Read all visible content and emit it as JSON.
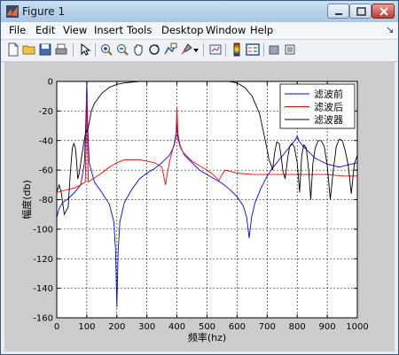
{
  "window": {
    "title": "Figure 1"
  },
  "menu": [
    "File",
    "Edit",
    "View",
    "Insert",
    "Tools",
    "Desktop",
    "Window",
    "Help"
  ],
  "toolbar_icons": [
    "new-file-icon",
    "open-folder-icon",
    "save-icon",
    "print-icon",
    "arrow-pointer-icon",
    "zoom-in-icon",
    "zoom-out-icon",
    "pan-hand-icon",
    "rotate-3d-icon",
    "data-cursor-icon",
    "brush-icon",
    "link-plot-icon",
    "colorbar-icon",
    "legend-icon",
    "hide-tools-icon",
    "show-tools-icon"
  ],
  "chart_data": {
    "type": "line",
    "title": "",
    "xlabel": "频率(hz)",
    "ylabel": "幅度(db)",
    "xlim": [
      0,
      1000
    ],
    "ylim": [
      -160,
      0
    ],
    "xticks": [
      "0",
      "100",
      "200",
      "300",
      "400",
      "500",
      "600",
      "700",
      "800",
      "900",
      "1000"
    ],
    "yticks": [
      "0",
      "-20",
      "-40",
      "-60",
      "-80",
      "-100",
      "-120",
      "-140",
      "-160"
    ],
    "grid": true,
    "legend_position": "top-right",
    "series": [
      {
        "name": "滤波前",
        "color": "#0000ff",
        "x": [
          0,
          8,
          20,
          40,
          60,
          80,
          92,
          97,
          100,
          103,
          108,
          125,
          150,
          175,
          190,
          196,
          200,
          204,
          210,
          225,
          250,
          275,
          300,
          325,
          350,
          375,
          390,
          397,
          400,
          403,
          410,
          425,
          450,
          475,
          500,
          525,
          550,
          575,
          600,
          620,
          632,
          640,
          648,
          660,
          680,
          700,
          720,
          740,
          760,
          780,
          795,
          800,
          805,
          820,
          840,
          860,
          880,
          900,
          920,
          940,
          960,
          980,
          1000
        ],
        "y": [
          -92,
          -86,
          -82,
          -79,
          -75,
          -70,
          -55,
          -25,
          0,
          -30,
          -55,
          -68,
          -75,
          -83,
          -95,
          -115,
          -153,
          -115,
          -95,
          -82,
          -73,
          -66,
          -62,
          -59,
          -55,
          -50,
          -44,
          -37,
          -28,
          -38,
          -44,
          -50,
          -55,
          -60,
          -63,
          -66,
          -69,
          -73,
          -78,
          -84,
          -92,
          -106,
          -92,
          -82,
          -72,
          -64,
          -58,
          -53,
          -48,
          -43,
          -39,
          -37,
          -40,
          -44,
          -48,
          -52,
          -54,
          -56,
          -57,
          -58,
          -57,
          -56,
          -55
        ]
      },
      {
        "name": "滤波后",
        "color": "#ff0000",
        "x": [
          0,
          20,
          40,
          60,
          80,
          95,
          100,
          105,
          120,
          150,
          175,
          200,
          225,
          250,
          275,
          300,
          325,
          350,
          362,
          370,
          378,
          390,
          397,
          400,
          403,
          410,
          420,
          450,
          475,
          500,
          520,
          540,
          550,
          560,
          580,
          600,
          650,
          700,
          750,
          800,
          850,
          900,
          950,
          1000
        ],
        "y": [
          -75,
          -74,
          -73,
          -72,
          -70,
          -68,
          -11,
          -68,
          -66,
          -62,
          -58,
          -55,
          -53,
          -53,
          -53,
          -54,
          -55,
          -58,
          -70,
          -60,
          -52,
          -43,
          -35,
          -18,
          -35,
          -43,
          -48,
          -54,
          -57,
          -60,
          -63,
          -67,
          -63,
          -60,
          -61,
          -62,
          -63,
          -63,
          -63,
          -63,
          -63,
          -63,
          -64,
          -64
        ]
      },
      {
        "name": "滤波器",
        "color": "#000000",
        "x": [
          0,
          8,
          15,
          25,
          38,
          45,
          52,
          57,
          62,
          66,
          70,
          75,
          85,
          92,
          98,
          102,
          108,
          115,
          125,
          150,
          175,
          200,
          225,
          250,
          275,
          300,
          325,
          350,
          375,
          400,
          425,
          450,
          475,
          500,
          525,
          550,
          575,
          600,
          625,
          650,
          675,
          700,
          706,
          712,
          718,
          725,
          732,
          740,
          746,
          752,
          760,
          768,
          775,
          782,
          790,
          800,
          808,
          815,
          822,
          830,
          838,
          845,
          852,
          860,
          870,
          880,
          890,
          900,
          910,
          920,
          930,
          940,
          950,
          960,
          970,
          980,
          990,
          1000
        ],
        "y": [
          -75,
          -70,
          -75,
          -90,
          -85,
          -62,
          -45,
          -42,
          -45,
          -54,
          -66,
          -62,
          -48,
          -39,
          -33,
          -34,
          -28,
          -20,
          -15,
          -8,
          -4,
          -2,
          -1,
          -0.5,
          0,
          0,
          0,
          0,
          0,
          0,
          0,
          0,
          0,
          0,
          0,
          0,
          0,
          -1,
          -4,
          -10,
          -22,
          -46,
          -53,
          -56,
          -60,
          -48,
          -41,
          -42,
          -50,
          -60,
          -66,
          -52,
          -44,
          -42,
          -44,
          -55,
          -75,
          -50,
          -43,
          -45,
          -60,
          -80,
          -56,
          -45,
          -40,
          -40,
          -44,
          -57,
          -80,
          -60,
          -44,
          -39,
          -40,
          -47,
          -57,
          -76,
          -56,
          -50
        ]
      }
    ]
  }
}
